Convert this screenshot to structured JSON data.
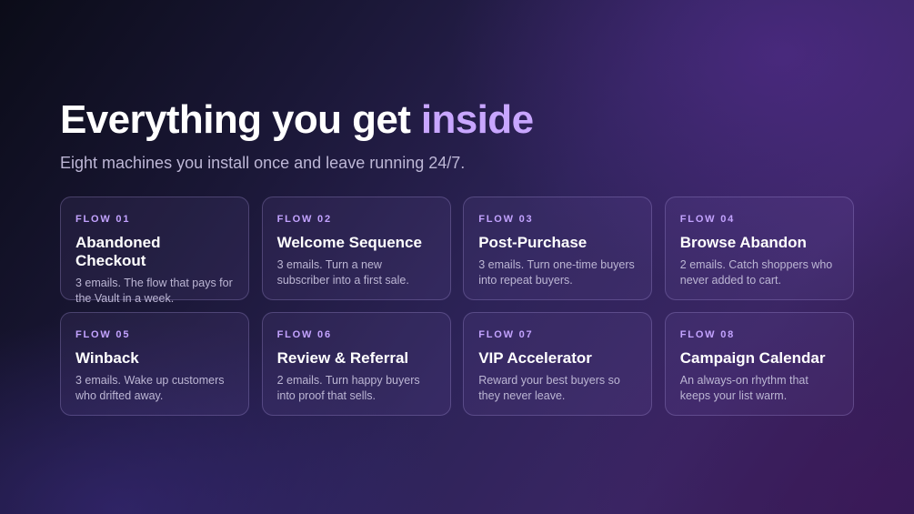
{
  "hero": {
    "headline_main": "Everything you get ",
    "headline_accent": "inside",
    "subtitle": "Eight machines you install once and leave running 24/7."
  },
  "flows": [
    {
      "label": "FLOW 01",
      "title": "Abandoned Checkout",
      "description": "3 emails. The flow that pays for the Vault in a week."
    },
    {
      "label": "FLOW 02",
      "title": "Welcome Sequence",
      "description": "3 emails. Turn a new subscriber into a first sale."
    },
    {
      "label": "FLOW 03",
      "title": "Post-Purchase",
      "description": "3 emails. Turn one-time buyers into repeat buyers."
    },
    {
      "label": "FLOW 04",
      "title": "Browse Abandon",
      "description": "2 emails. Catch shoppers who never added to cart."
    },
    {
      "label": "FLOW 05",
      "title": "Winback",
      "description": "3 emails. Wake up customers who drifted away."
    },
    {
      "label": "FLOW 06",
      "title": "Review & Referral",
      "description": "2 emails. Turn happy buyers into proof that sells."
    },
    {
      "label": "FLOW 07",
      "title": "VIP Accelerator",
      "description": "Reward your best buyers so they never leave."
    },
    {
      "label": "FLOW 08",
      "title": "Campaign Calendar",
      "description": "An always-on rhythm that keeps your list warm."
    }
  ],
  "colors": {
    "accent": "#c8a6ff",
    "label": "#c3a3ff"
  }
}
